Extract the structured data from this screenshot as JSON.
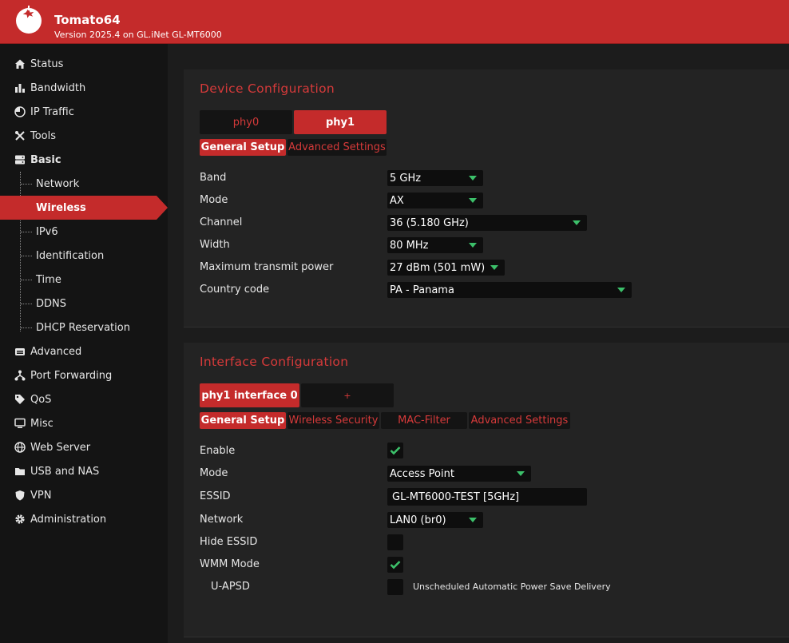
{
  "header": {
    "title": "Tomato64",
    "version": "Version 2025.4 on GL.iNet GL-MT6000"
  },
  "sidebar": {
    "items": [
      {
        "label": "Status",
        "icon": "home-icon"
      },
      {
        "label": "Bandwidth",
        "icon": "bar-chart-icon"
      },
      {
        "label": "IP Traffic",
        "icon": "pie-chart-icon"
      },
      {
        "label": "Tools",
        "icon": "tools-icon"
      },
      {
        "label": "Basic",
        "icon": "server-icon"
      },
      {
        "label": "Advanced",
        "icon": "router-icon"
      },
      {
        "label": "Port Forwarding",
        "icon": "network-tree-icon"
      },
      {
        "label": "QoS",
        "icon": "tag-icon"
      },
      {
        "label": "Misc",
        "icon": "monitor-icon"
      },
      {
        "label": "Web Server",
        "icon": "globe-icon"
      },
      {
        "label": "USB and NAS",
        "icon": "folder-icon"
      },
      {
        "label": "VPN",
        "icon": "shield-icon"
      },
      {
        "label": "Administration",
        "icon": "gear-icon"
      }
    ],
    "basic_sub": [
      "Network",
      "Wireless",
      "IPv6",
      "Identification",
      "Time",
      "DDNS",
      "DHCP Reservation"
    ]
  },
  "device_config": {
    "title": "Device Configuration",
    "tabs": [
      "phy0",
      "phy1"
    ],
    "subtabs": [
      "General Setup",
      "Advanced Settings"
    ],
    "fields": [
      {
        "label": "Band",
        "value": "5 GHz"
      },
      {
        "label": "Mode",
        "value": "AX"
      },
      {
        "label": "Channel",
        "value": "36 (5.180 GHz)"
      },
      {
        "label": "Width",
        "value": "80 MHz"
      },
      {
        "label": "Maximum transmit power",
        "value": "27 dBm (501 mW)"
      },
      {
        "label": "Country code",
        "value": "PA - Panama"
      }
    ]
  },
  "interface_config": {
    "title": "Interface Configuration",
    "tabs": [
      "phy1 interface 0",
      "+"
    ],
    "subtabs": [
      "General Setup",
      "Wireless Security",
      "MAC-Filter",
      "Advanced Settings"
    ],
    "fields": {
      "enable_label": "Enable",
      "enable_checked": true,
      "mode_label": "Mode",
      "mode_value": "Access Point",
      "essid_label": "ESSID",
      "essid_value": "GL-MT6000-TEST [5GHz]",
      "network_label": "Network",
      "network_value": "LAN0 (br0)",
      "hide_essid_label": "Hide ESSID",
      "hide_essid_checked": false,
      "wmm_label": "WMM Mode",
      "wmm_checked": true,
      "uapsd_label": "U-APSD",
      "uapsd_checked": false,
      "uapsd_hint": "Unscheduled Automatic Power Save Delivery"
    }
  },
  "colors": {
    "accent": "#c42b2b",
    "accent_text": "#d63a3a",
    "check": "#3cc06a"
  }
}
